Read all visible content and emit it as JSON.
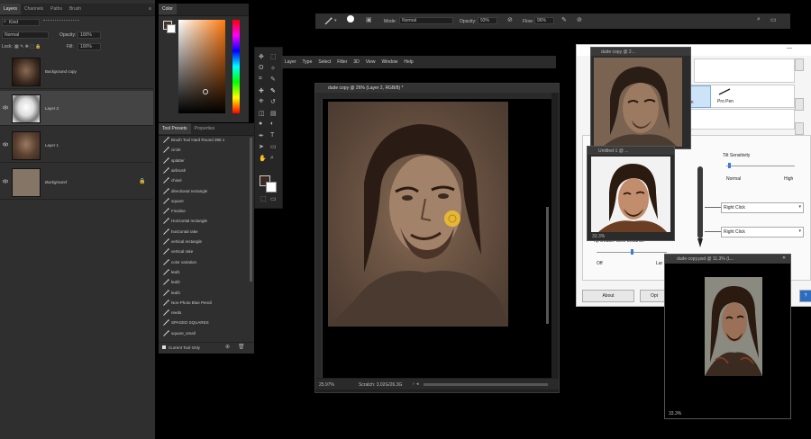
{
  "layers_panel": {
    "tabs": [
      "Layers",
      "Channels",
      "Paths",
      "Brush"
    ],
    "kind_label": "Kind",
    "blend_mode": "Normal",
    "opacity_label": "Opacity:",
    "opacity_value": "100%",
    "lock_label": "Lock:",
    "fill_label": "Fill:",
    "fill_value": "100%",
    "layers": [
      {
        "name": "Background copy"
      },
      {
        "name": "Layer 2"
      },
      {
        "name": "Layer 1"
      },
      {
        "name": "Background"
      }
    ]
  },
  "color_panel": {
    "tab": "Color"
  },
  "tool_presets": {
    "tabs": [
      "Tool Presets",
      "Properties"
    ],
    "items": [
      "Brush Tool Hard Round 395 1",
      "circle",
      "splatter",
      "airbrush",
      "chisel",
      "directional rectangle",
      "square",
      "Finaline",
      "Horizontal rectangle",
      "horizontal rake",
      "vertical rectangle",
      "vertical rake",
      "color variation",
      "leaf1",
      "leaf2",
      "leaf3",
      "Non-Photo Blue Pencil",
      "reeds",
      "SPAGED SQUARES",
      "square_small"
    ],
    "footer": "Current Tool Only"
  },
  "menu": [
    "Layer",
    "Type",
    "Select",
    "Filter",
    "3D",
    "View",
    "Window",
    "Help"
  ],
  "options_bar": {
    "mode_label": "Mode:",
    "mode_value": "Normal",
    "opacity_label": "Opacity:",
    "opacity_value": "93%",
    "flow_label": "Flow:",
    "flow_value": "96%"
  },
  "main_doc": {
    "title": "dude copy @ 26% (Layer 2, RGB/8) *",
    "zoom": "25.97%",
    "status": "Scratch: 3.02G/26.3G"
  },
  "doc_small1": {
    "title": "dude copy @ 2..."
  },
  "doc_small2": {
    "title": "Untitled-1 @ ...",
    "zoom": "33.3%"
  },
  "doc_small3": {
    "title": "dude copy.psd @ 11.3% (L...",
    "zoom": "33.3%"
  },
  "tablet_dialog": {
    "pen_label": "Pro Pen",
    "pen_label_cut": "en",
    "tilt_label": "Tilt Sensitivity",
    "tilt_min": "Normal",
    "tilt_max": "High",
    "double_click_label": "Tip Double Click Distance",
    "dc_min": "Off",
    "dc_max": "Lar",
    "button1": "Right Click",
    "button2": "Right Click",
    "about_btn": "About",
    "options_btn": "Opt"
  },
  "colors": {
    "accent": "#f2c12e",
    "canvas_bg": "#000000",
    "panel_bg": "#2f2f2f"
  }
}
